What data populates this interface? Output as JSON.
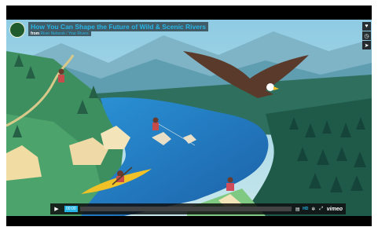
{
  "video": {
    "channel_logo_text": "",
    "title": "How You Can Shape the Future of Wild & Scenic Rivers",
    "byline_from": "from",
    "byline_author": "River Network / Your Rivers",
    "scene": "animated illustration: river valley with eagle, kayaker, fisherman, hiker"
  },
  "side_actions": [
    {
      "name": "like-icon",
      "glyph": "♥"
    },
    {
      "name": "watch-later-icon",
      "glyph": "◷"
    },
    {
      "name": "share-icon",
      "glyph": "➤"
    }
  ],
  "controls": {
    "timecode": "00:00",
    "progress": 0.0,
    "buttons": {
      "play": "▶",
      "volume": "▤",
      "hd": "HD",
      "settings": "✲",
      "fullscreen": "⤢"
    },
    "brand": "vimeo"
  },
  "colors": {
    "accent": "#27b6e8",
    "sky": "#9fd0e6",
    "water": "#2c7ec4",
    "forest": "#1f5a49",
    "kayak": "#f0c228"
  }
}
